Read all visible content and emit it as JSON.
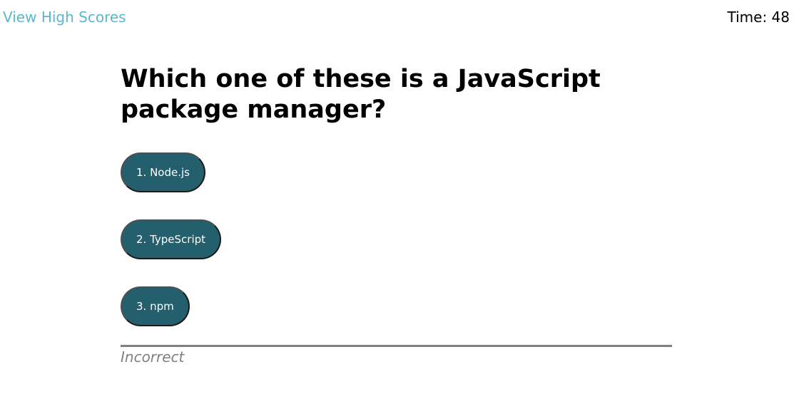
{
  "header": {
    "high_scores_link": "View High Scores",
    "timer_label": "Time: ",
    "timer_value": "48"
  },
  "quiz": {
    "question": "Which one of these is a JavaScript package manager?",
    "choices": [
      {
        "label": "1. Node.js"
      },
      {
        "label": "2. TypeScript"
      },
      {
        "label": "3. npm"
      }
    ],
    "feedback": "Incorrect"
  },
  "colors": {
    "link": "#5bb8c9",
    "button_bg": "#245f6d",
    "button_text": "#ffffff",
    "divider": "#808080",
    "feedback_text": "#808080"
  }
}
